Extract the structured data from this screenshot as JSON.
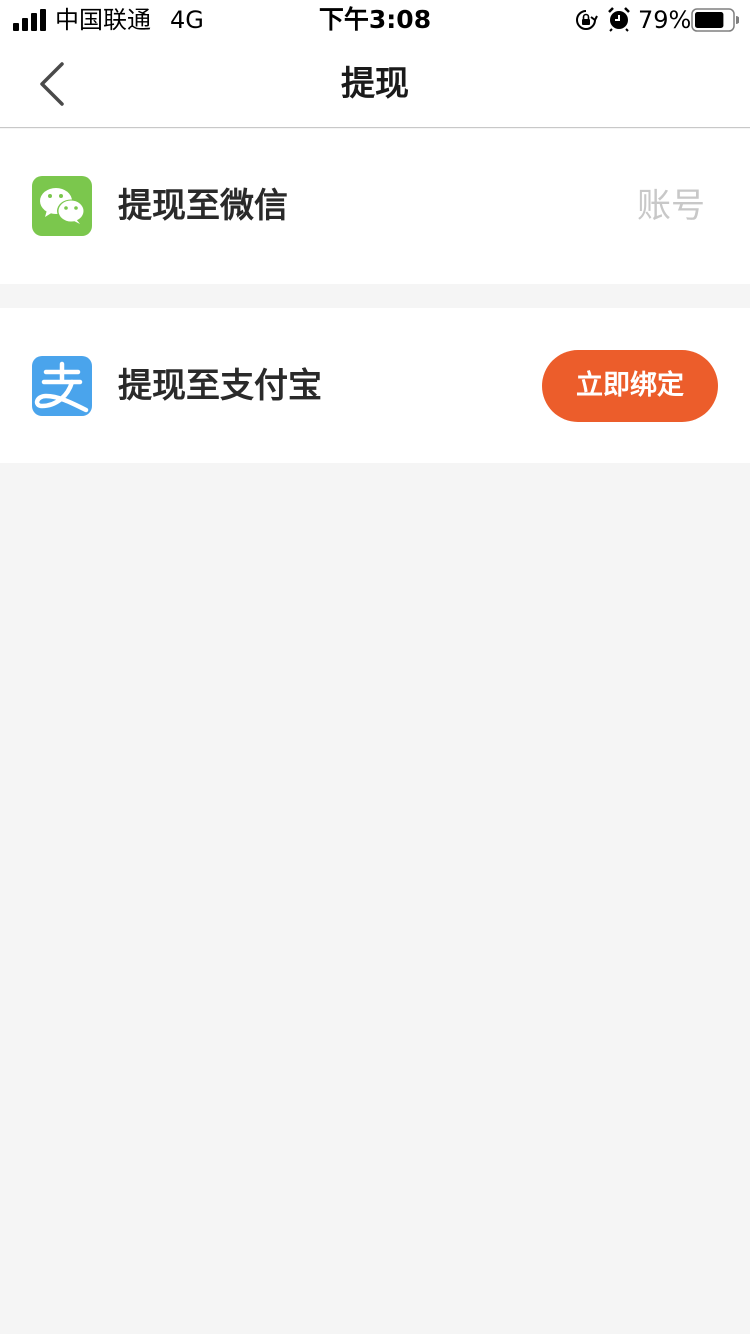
{
  "status_bar": {
    "carrier": "中国联通",
    "network": "4G",
    "time": "下午3:08",
    "battery": "79%",
    "battery_level": 0.79
  },
  "nav": {
    "title": "提现",
    "back_icon": "chevron-left-icon"
  },
  "options": {
    "wechat": {
      "icon": "wechat-icon",
      "label": "提现至微信",
      "account": "账号",
      "accent": "#7bc74d"
    },
    "alipay": {
      "icon": "alipay-icon",
      "label": "提现至支付宝",
      "button_label": "立即绑定",
      "accent": "#4aa4ec"
    }
  },
  "colors": {
    "primary_button": "#ec5d2b",
    "background": "#f5f5f5"
  }
}
